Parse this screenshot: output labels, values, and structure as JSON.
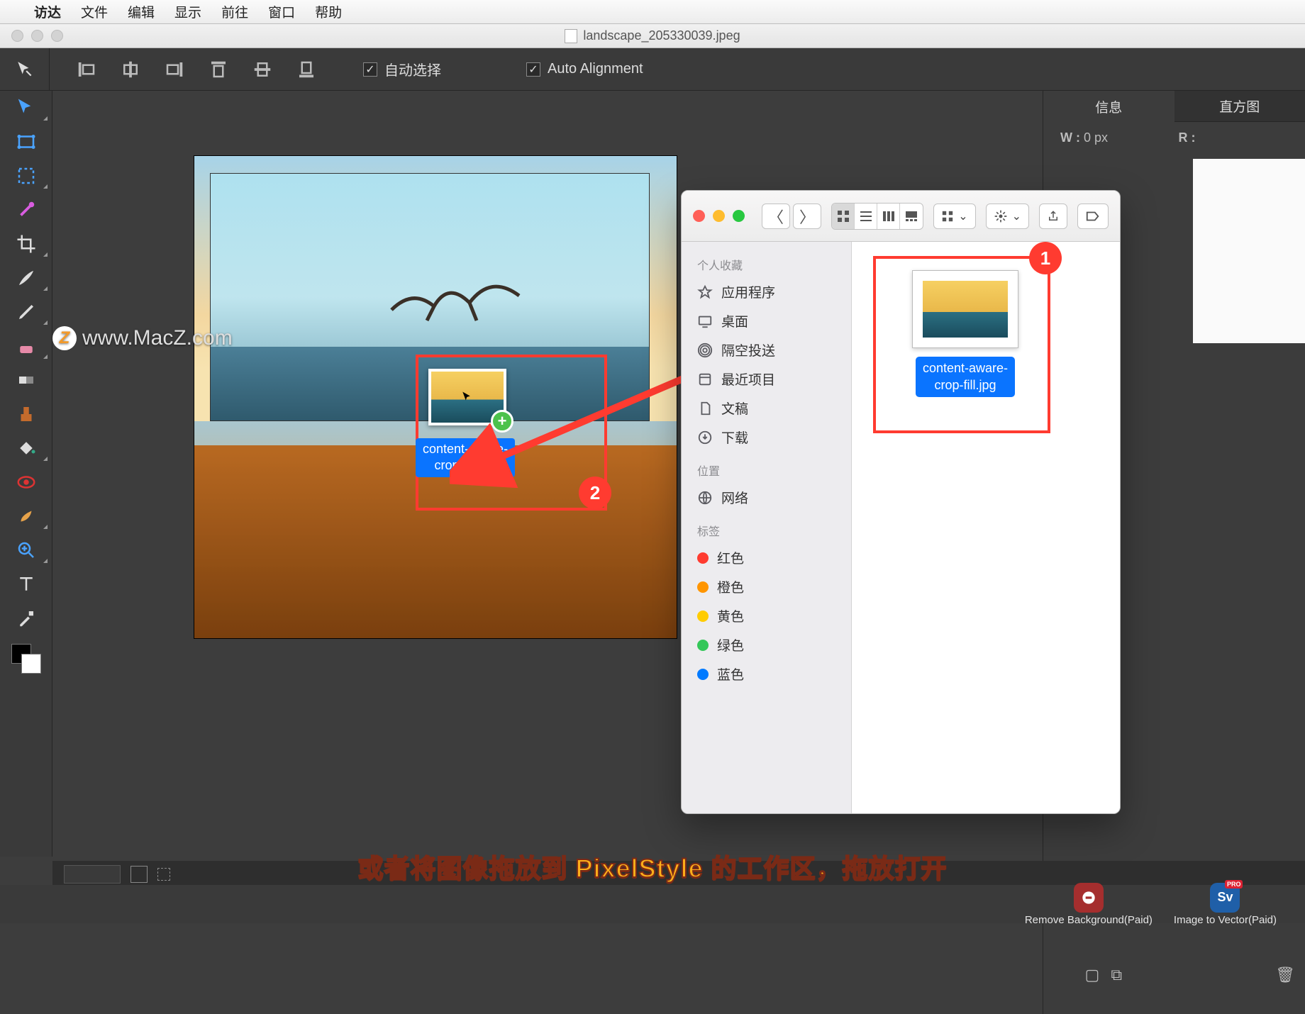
{
  "menubar": {
    "appname": "访达",
    "items": [
      "文件",
      "编辑",
      "显示",
      "前往",
      "窗口",
      "帮助"
    ]
  },
  "window": {
    "title": "landscape_205330039.jpeg"
  },
  "optionsbar": {
    "auto_select_label": "自动选择",
    "auto_align_label": "Auto Alignment"
  },
  "rightpanel": {
    "tabs": {
      "info": "信息",
      "histogram": "直方图"
    },
    "info": {
      "w_label": "W :",
      "w_value": "0 px",
      "r_label": "R :"
    }
  },
  "finder": {
    "sidebar": {
      "favorites_title": "个人收藏",
      "favorites": [
        "应用程序",
        "桌面",
        "隔空投送",
        "最近项目",
        "文稿",
        "下载"
      ],
      "locations_title": "位置",
      "locations": [
        "网络"
      ],
      "tags_title": "标签",
      "tags": [
        {
          "label": "红色",
          "color": "#ff3b30"
        },
        {
          "label": "橙色",
          "color": "#ff9500"
        },
        {
          "label": "黄色",
          "color": "#ffcc00"
        },
        {
          "label": "绿色",
          "color": "#34c759"
        },
        {
          "label": "蓝色",
          "color": "#007aff"
        }
      ]
    },
    "file": {
      "name_line1": "content-aware-",
      "name_line2": "crop-fill.jpg"
    }
  },
  "drag": {
    "name_line1": "content-aware-",
    "name_line2": "crop-fill.jpg"
  },
  "annotations": {
    "badge1": "1",
    "badge2": "2"
  },
  "watermark": {
    "text": "www.MacZ.com",
    "logo_letter": "Z"
  },
  "caption": "或者将图像拖放到 PixelStyle 的工作区，拖放打开",
  "dock": {
    "remove_bg": "Remove Background(Paid)",
    "img2vec": "Image to Vector(Paid)",
    "sv_text": "Sv",
    "pro": "PRO"
  }
}
